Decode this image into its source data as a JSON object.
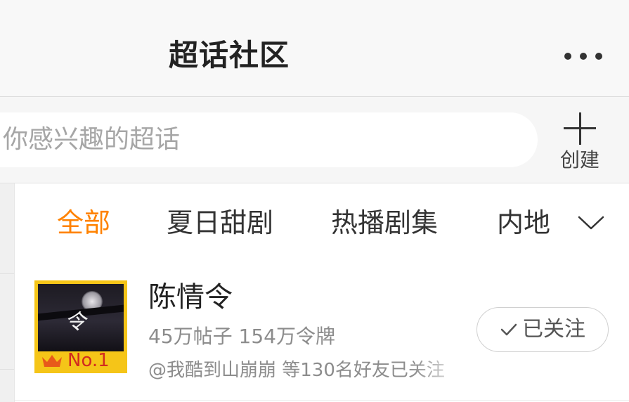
{
  "header": {
    "title": "超话社区",
    "more_icon": "more-dots-icon"
  },
  "search": {
    "placeholder_text": "你感兴趣的超话",
    "create_label": "创建",
    "create_icon": "plus-icon"
  },
  "tabs": [
    {
      "label": "全部",
      "active": true
    },
    {
      "label": "夏日甜剧",
      "active": false
    },
    {
      "label": "热播剧集",
      "active": false
    },
    {
      "label": "内地",
      "active": false
    }
  ],
  "tabs_expand_icon": "chevron-down-icon",
  "topic": {
    "title": "陈情令",
    "stats": "45万帖子 154万令牌",
    "friends": "@我酷到山崩崩 等130名好友已关注",
    "rank_label": "No.1",
    "rank_icon": "crown-icon",
    "follow_label": "已关注",
    "follow_icon": "check-icon"
  },
  "colors": {
    "accent": "#ff8200",
    "rank_bg": "#f5c518",
    "rank_text": "#d22b1f"
  }
}
